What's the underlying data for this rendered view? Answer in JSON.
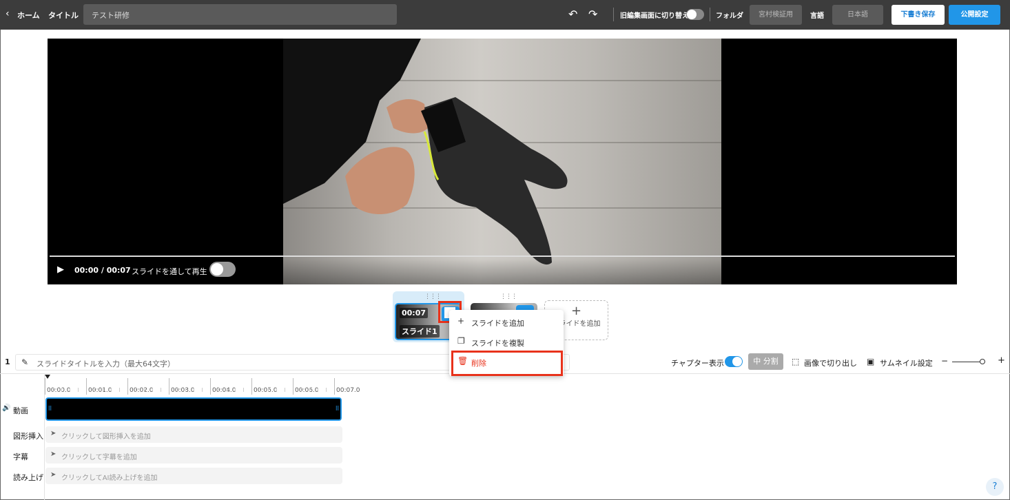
{
  "header": {
    "home_label": "ホーム",
    "title_label": "タイトル",
    "title_value": "テスト研修",
    "old_editor_label": "旧編集画面に切り替え",
    "folder_label": "フォルダ",
    "folder_value": "宮村検証用",
    "language_label": "言語",
    "language_value": "日本語",
    "save_draft_label": "下書き保存",
    "publish_label": "公開設定"
  },
  "player": {
    "time_display": "00:00 / 00:07",
    "play_through_label": "スライドを通して再生"
  },
  "slides": {
    "items": [
      {
        "time": "00:07",
        "name": "スライド1",
        "selected": true
      },
      {
        "time": "",
        "name": "",
        "selected": false
      }
    ],
    "add_label": "スライドを追加"
  },
  "context_menu": {
    "items": [
      {
        "label": "スライドを追加",
        "icon": "plus-icon"
      },
      {
        "label": "スライドを複製",
        "icon": "copy-icon"
      },
      {
        "label": "削除",
        "icon": "trash-icon"
      }
    ]
  },
  "slide_bar": {
    "slide_number": "1",
    "title_placeholder": "スライドタイトルを入力（最大64文字）",
    "chapter_label": "チャプター表示",
    "split_label": "分割",
    "crop_label": "画像で切り出し",
    "thumbnail_label": "サムネイル設定"
  },
  "timeline": {
    "ruler": [
      "00:00.0",
      "00:01.0",
      "00:02.0",
      "00:03.0",
      "00:04.0",
      "00:05.0",
      "00:06.0",
      "00:07.0"
    ],
    "tracks": {
      "video_label": "動画",
      "shape_label": "図形挿入",
      "shape_placeholder": "クリックして図形挿入を追加",
      "caption_label": "字幕",
      "caption_placeholder": "クリックして字幕を追加",
      "narration_label": "読み上げ",
      "narration_placeholder": "クリックしてAI読み上げを追加"
    }
  },
  "help_label": "?",
  "colors": {
    "accent": "#2196e8",
    "highlight": "#e8321b",
    "topbar": "#3c3c3c"
  }
}
